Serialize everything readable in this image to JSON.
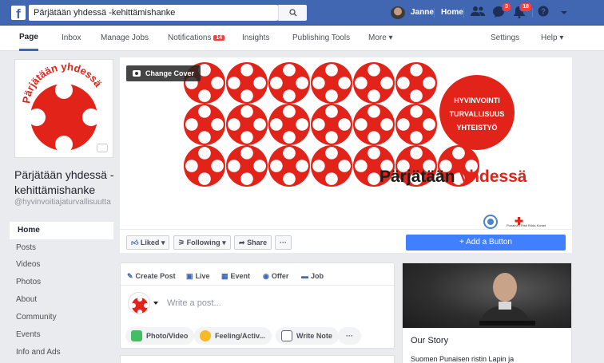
{
  "topbar": {
    "search_value": "Pärjätään yhdessä -kehittämishanke",
    "user_name": "Janne",
    "home_label": "Home",
    "friend_requests_badge": "",
    "messages_badge": "3",
    "notifications_badge": "18"
  },
  "subnav": {
    "items": [
      "Page",
      "Inbox",
      "Manage Jobs",
      "Notifications",
      "Insights",
      "Publishing Tools",
      "More ▾",
      "Settings",
      "Help ▾"
    ],
    "notifications_badge": "14"
  },
  "page": {
    "name": "Pärjätään yhdessä -kehittämishanke",
    "handle": "@hyvinvoitiajaturvallisuutta",
    "profile_logo_text": "Pärjätään yhdessä"
  },
  "left_nav": [
    "Home",
    "Posts",
    "Videos",
    "Photos",
    "About",
    "Community",
    "Events",
    "Info and Ads"
  ],
  "cover": {
    "change_cover_label": "Change Cover",
    "circle_lines": [
      "HYVINVOINTI",
      "TURVALLISUUS",
      "YHTEISTYÖ"
    ],
    "wordmark_black": "Pärjätään ",
    "wordmark_red": "yhdessä",
    "partner_label": "Punainen Risti Röda Korset"
  },
  "actions": {
    "liked": "Liked ▾",
    "following": "Following ▾",
    "share": "Share",
    "more": "···",
    "add_button": "+ Add a Button"
  },
  "composer": {
    "tabs": [
      "Create Post",
      "Live",
      "Event",
      "Offer",
      "Job"
    ],
    "placeholder": "Write a post...",
    "buttons": [
      "Photo/Video",
      "Feeling/Activ...",
      "Write Note",
      "···"
    ]
  },
  "story": {
    "title": "Our Story",
    "text": "Suomen Punaisen ristin Lapin ja"
  },
  "colors": {
    "facebook_blue": "#4267b2",
    "brand_red": "#e2231a",
    "button_blue": "#4080ff"
  }
}
